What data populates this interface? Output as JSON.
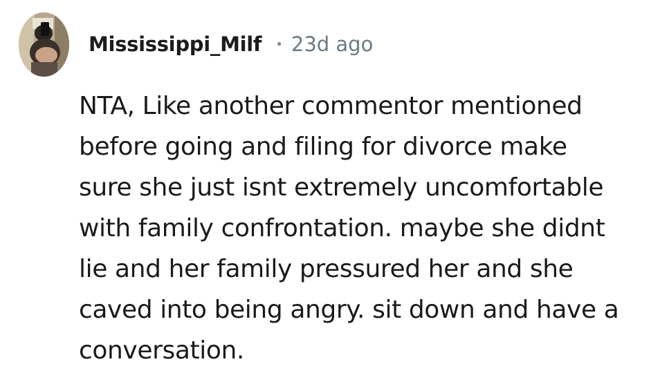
{
  "comment": {
    "author": "Mississippi_Milf",
    "separator": "•",
    "timestamp": "23d ago",
    "avatar_icon": "user-avatar-photo",
    "body_lines": [
      "NTA, Like another commentor mentioned",
      "before going and filing for divorce make",
      "sure she just isnt extremely uncomfortable",
      "with family confrontation. maybe she didnt",
      "lie and her family pressured her and she",
      "caved into being angry. sit down and have a",
      "conversation."
    ]
  }
}
